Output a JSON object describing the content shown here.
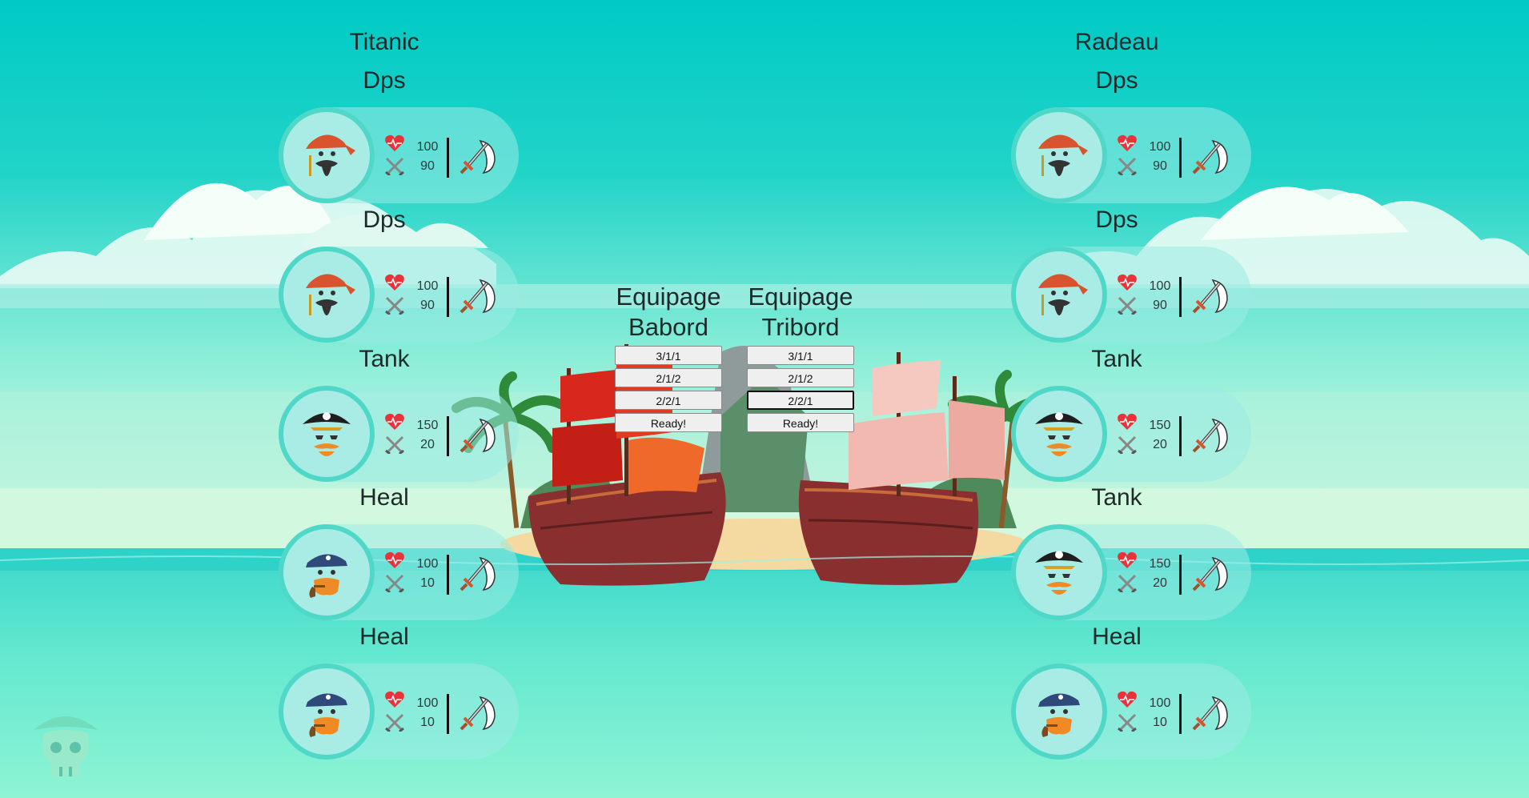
{
  "teams": [
    {
      "name": "Titanic",
      "slots": [
        {
          "role": "Dps",
          "avatar": "red-bandana-pirate",
          "hp": "100",
          "atk": "90"
        },
        {
          "role": "Dps",
          "avatar": "red-bandana-pirate",
          "hp": "100",
          "atk": "90"
        },
        {
          "role": "Tank",
          "avatar": "captain-hat-pirate",
          "hp": "150",
          "atk": "20"
        },
        {
          "role": "Heal",
          "avatar": "blue-bandana-pipe-pirate",
          "hp": "100",
          "atk": "10"
        },
        {
          "role": "Heal",
          "avatar": "blue-bandana-pipe-pirate",
          "hp": "100",
          "atk": "10"
        }
      ]
    },
    {
      "name": "Radeau",
      "slots": [
        {
          "role": "Dps",
          "avatar": "red-bandana-pirate",
          "hp": "100",
          "atk": "90"
        },
        {
          "role": "Dps",
          "avatar": "red-bandana-pirate",
          "hp": "100",
          "atk": "90"
        },
        {
          "role": "Tank",
          "avatar": "captain-hat-pirate",
          "hp": "150",
          "atk": "20"
        },
        {
          "role": "Tank",
          "avatar": "captain-hat-pirate",
          "hp": "150",
          "atk": "20"
        },
        {
          "role": "Heal",
          "avatar": "blue-bandana-pipe-pirate",
          "hp": "100",
          "atk": "10"
        }
      ]
    }
  ],
  "crews": [
    {
      "title_line1": "Equipage",
      "title_line2": "Babord",
      "options": [
        "3/1/1",
        "2/1/2",
        "2/2/1"
      ],
      "ready_label": "Ready!"
    },
    {
      "title_line1": "Equipage",
      "title_line2": "Tribord",
      "options": [
        "3/1/1",
        "2/1/2",
        "2/2/1"
      ],
      "ready_label": "Ready!"
    }
  ],
  "icons": {
    "health": "heart-pulse-icon",
    "attack": "crossed-swords-icon",
    "weapon": "sword-icon",
    "logo": "pirate-skull-logo"
  },
  "colors": {
    "card_ring": "#4fd8c8",
    "heart": "#e8333a",
    "left_sail": "#d8281e",
    "right_sail": "#f2b9b0"
  }
}
